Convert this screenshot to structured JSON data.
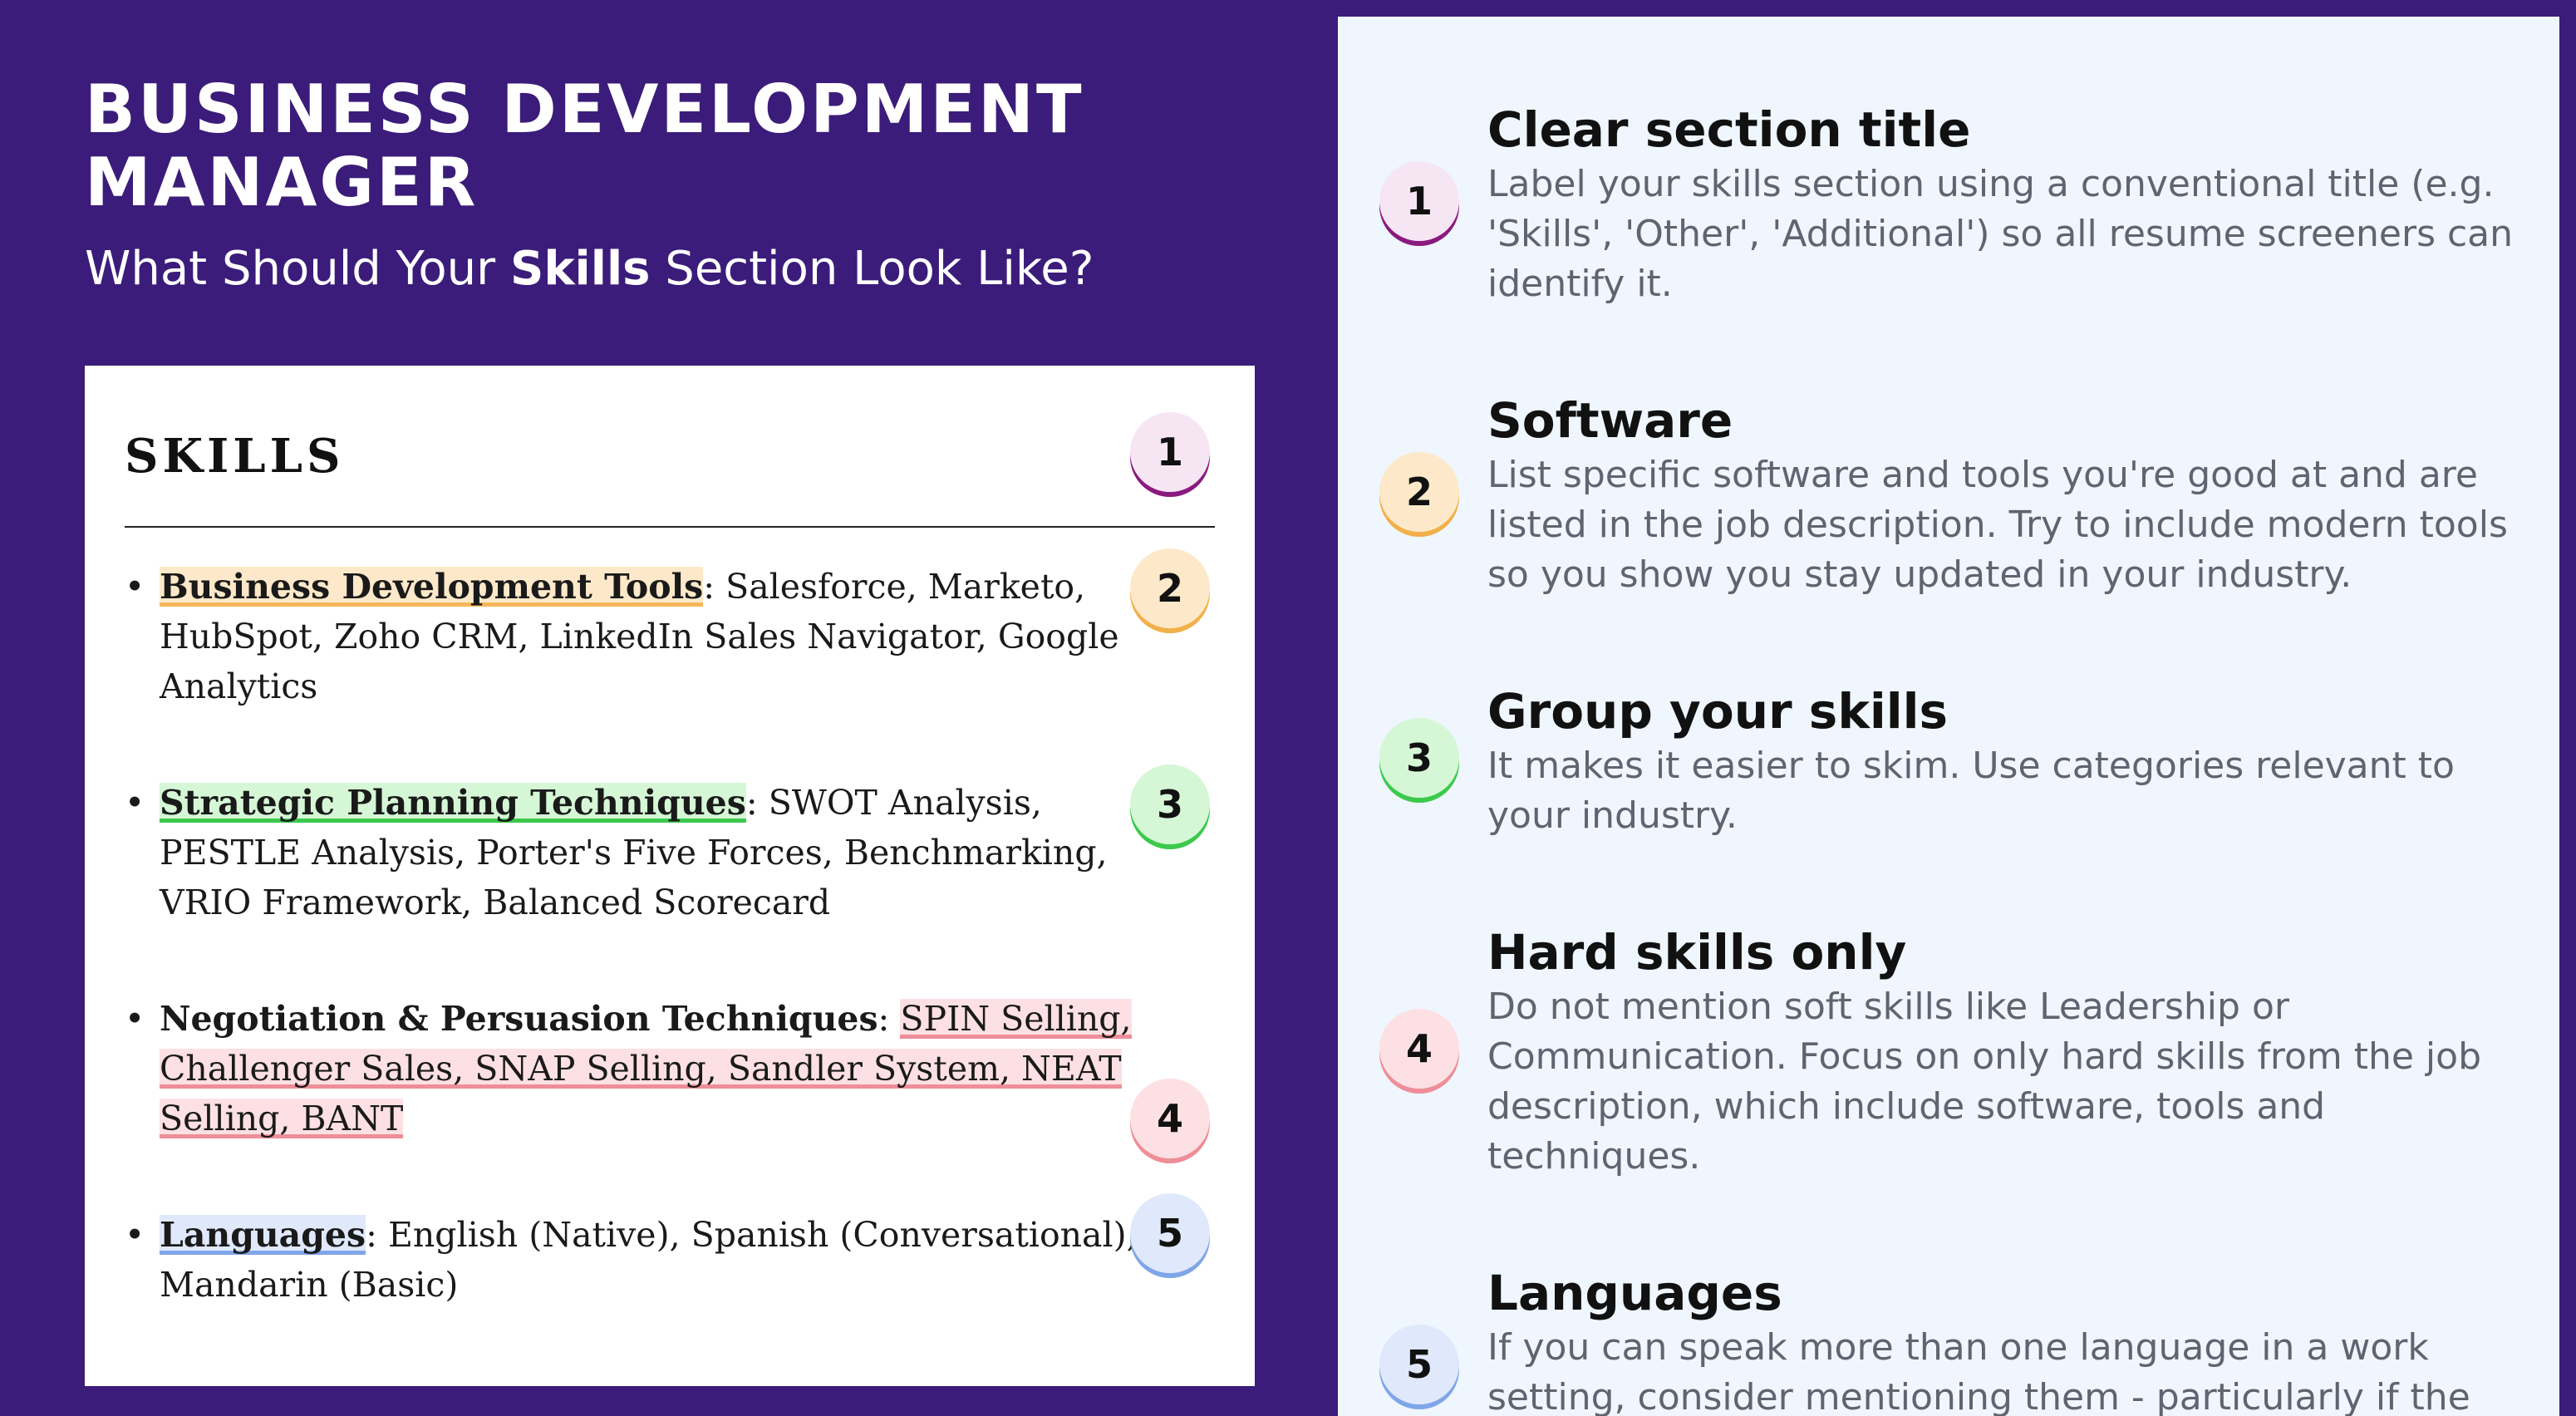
{
  "header": {
    "title": "BUSINESS DEVELOPMENT MANAGER",
    "subtitle_pre": "What Should Your ",
    "subtitle_bold": "Skills",
    "subtitle_post": " Section Look Like?"
  },
  "resume": {
    "heading": "SKILLS",
    "bullet": "•",
    "items": [
      {
        "category": "Business Development Tools",
        "separator": ":",
        "text": " Salesforce, Marketo, HubSpot, Zoho CRM, LinkedIn Sales Navigator, Google Analytics"
      },
      {
        "category": "Strategic Planning Techniques",
        "separator": ":",
        "text": " SWOT Analysis, PESTLE Analysis, Porter's Five Forces, Benchmarking, VRIO Framework, Balanced Scorecard"
      },
      {
        "category": "Negotiation & Persuasion Techniques",
        "separator": ": ",
        "text": "SPIN Selling, Challenger Sales, SNAP Selling, Sandler System, NEAT Selling, BANT"
      },
      {
        "category": "Languages",
        "separator": ":",
        "text": " English (Native), Spanish (Conversational), Mandarin (Basic)"
      }
    ]
  },
  "badges": [
    "1",
    "2",
    "3",
    "4",
    "5"
  ],
  "tips": [
    {
      "title": "Clear section title",
      "text": "Label your skills section using a conventional title (e.g. 'Skills', 'Other', 'Additional') so all resume screeners can identify it."
    },
    {
      "title": "Software",
      "text": "List specific software and tools you're good at and are listed in the job description. Try to include modern tools so you show you stay updated in your industry."
    },
    {
      "title": "Group your skills",
      "text": "It makes it easier to skim. Use categories relevant to your industry."
    },
    {
      "title": "Hard skills only",
      "text": "Do not mention soft skills like Leadership or Communication. Focus on only hard skills from the job description, which include software, tools and techniques."
    },
    {
      "title": "Languages",
      "text": "If you can speak more than one language in a work setting, consider mentioning them - particularly if the job"
    }
  ],
  "colors": {
    "background": "#3b1c7a",
    "panel": "#eff6fd",
    "highlight_tools": "#fde9c9",
    "highlight_planning": "#d5f7d6",
    "highlight_negotiation": "#fde0e3",
    "highlight_languages": "#dfe9fb"
  }
}
